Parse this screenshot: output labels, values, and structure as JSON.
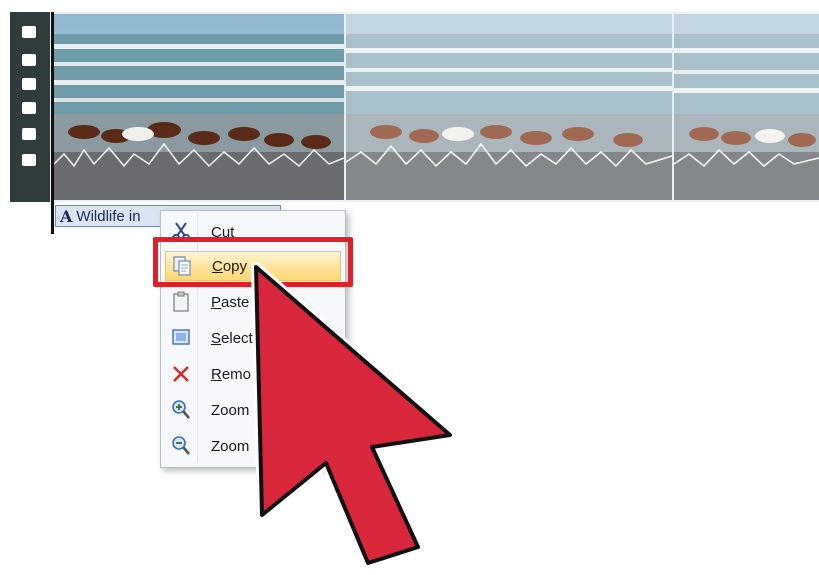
{
  "timeline": {
    "caption_icon": "A",
    "caption_text": "Wildlife in"
  },
  "context_menu": {
    "items": [
      {
        "label": "Cut",
        "icon": "scissors-icon"
      },
      {
        "label": "Copy",
        "icon": "copy-icon"
      },
      {
        "label": "Paste",
        "icon": "paste-icon"
      },
      {
        "label": "Select",
        "icon": "select-icon"
      },
      {
        "label": "Remo",
        "icon": "remove-x-icon"
      },
      {
        "label": "Zoom",
        "icon": "zoom-in-icon"
      },
      {
        "label": "Zoom",
        "icon": "zoom-out-icon"
      }
    ],
    "highlighted_item": "Copy"
  },
  "colors": {
    "highlight_border": "#e01f2a",
    "cursor_fill": "#d8263a",
    "menu_highlight": "#ffe39a"
  }
}
